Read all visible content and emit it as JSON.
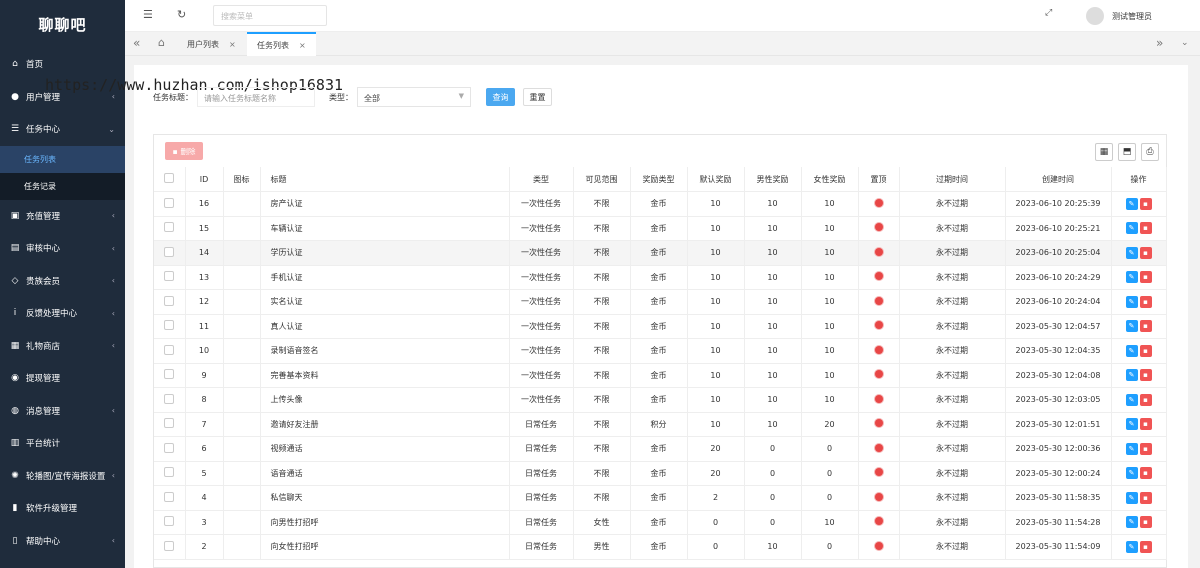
{
  "app": {
    "logo": "聊聊吧"
  },
  "sidebar": {
    "items": [
      {
        "icon": "home-icon",
        "glyph": "⌂",
        "label": "首页",
        "arrow": ""
      },
      {
        "icon": "user-icon",
        "glyph": "●",
        "label": "用户管理",
        "arrow": "‹"
      },
      {
        "icon": "list-icon",
        "glyph": "☰",
        "label": "任务中心",
        "arrow": "⌄"
      }
    ],
    "sub_items": [
      {
        "label": "任务列表"
      },
      {
        "label": "任务记录"
      }
    ],
    "items2": [
      {
        "icon": "gift-box-icon",
        "glyph": "▣",
        "label": "充值管理",
        "arrow": "‹"
      },
      {
        "icon": "stamp-icon",
        "glyph": "▤",
        "label": "审核中心",
        "arrow": "‹"
      },
      {
        "icon": "diamond-icon",
        "glyph": "◇",
        "label": "贵族会员",
        "arrow": "‹"
      },
      {
        "icon": "info-icon",
        "glyph": "i",
        "label": "反馈处理中心",
        "arrow": "‹"
      },
      {
        "icon": "gift-icon",
        "glyph": "▦",
        "label": "礼物商店",
        "arrow": "‹"
      },
      {
        "icon": "money-bag-icon",
        "glyph": "◉",
        "label": "提现管理",
        "arrow": ""
      },
      {
        "icon": "chat-icon",
        "glyph": "◍",
        "label": "消息管理",
        "arrow": "‹"
      },
      {
        "icon": "bar-chart-icon",
        "glyph": "▥",
        "label": "平台统计",
        "arrow": ""
      },
      {
        "icon": "gear-icon",
        "glyph": "✺",
        "label": "轮播图/宣传海报设置",
        "arrow": "‹"
      },
      {
        "icon": "lock-icon",
        "glyph": "▮",
        "label": "软件升级管理",
        "arrow": ""
      },
      {
        "icon": "book-icon",
        "glyph": "▯",
        "label": "帮助中心",
        "arrow": "‹"
      }
    ]
  },
  "header": {
    "search_placeholder": "搜索菜单",
    "user_name": "测试管理员"
  },
  "tabs": [
    {
      "label": "用户列表"
    },
    {
      "label": "任务列表"
    }
  ],
  "watermark": "https://www.huzhan.com/ishop16831",
  "filters": {
    "title_label": "任务标题：",
    "title_placeholder": "请输入任务标题名称",
    "type_label": "类型：",
    "type_value": "全部",
    "query_label": "查询",
    "reset_label": "重置"
  },
  "toolbar": {
    "delete_label": "删除"
  },
  "table": {
    "columns": [
      "ID",
      "图标",
      "标题",
      "类型",
      "可见范围",
      "奖励类型",
      "默认奖励",
      "男性奖励",
      "女性奖励",
      "置顶",
      "过期时间",
      "创建时间",
      "操作"
    ],
    "rows": [
      {
        "id": "16",
        "title": "房产认证",
        "type": "一次性任务",
        "scope": "不限",
        "reward_type": "金币",
        "default": "10",
        "male": "10",
        "female": "10",
        "expire": "永不过期",
        "created": "2023-06-10 20:25:39"
      },
      {
        "id": "15",
        "title": "车辆认证",
        "type": "一次性任务",
        "scope": "不限",
        "reward_type": "金币",
        "default": "10",
        "male": "10",
        "female": "10",
        "expire": "永不过期",
        "created": "2023-06-10 20:25:21"
      },
      {
        "id": "14",
        "title": "学历认证",
        "type": "一次性任务",
        "scope": "不限",
        "reward_type": "金币",
        "default": "10",
        "male": "10",
        "female": "10",
        "expire": "永不过期",
        "created": "2023-06-10 20:25:04"
      },
      {
        "id": "13",
        "title": "手机认证",
        "type": "一次性任务",
        "scope": "不限",
        "reward_type": "金币",
        "default": "10",
        "male": "10",
        "female": "10",
        "expire": "永不过期",
        "created": "2023-06-10 20:24:29"
      },
      {
        "id": "12",
        "title": "实名认证",
        "type": "一次性任务",
        "scope": "不限",
        "reward_type": "金币",
        "default": "10",
        "male": "10",
        "female": "10",
        "expire": "永不过期",
        "created": "2023-06-10 20:24:04"
      },
      {
        "id": "11",
        "title": "真人认证",
        "type": "一次性任务",
        "scope": "不限",
        "reward_type": "金币",
        "default": "10",
        "male": "10",
        "female": "10",
        "expire": "永不过期",
        "created": "2023-05-30 12:04:57"
      },
      {
        "id": "10",
        "title": "录制语音签名",
        "type": "一次性任务",
        "scope": "不限",
        "reward_type": "金币",
        "default": "10",
        "male": "10",
        "female": "10",
        "expire": "永不过期",
        "created": "2023-05-30 12:04:35"
      },
      {
        "id": "9",
        "title": "完善基本资料",
        "type": "一次性任务",
        "scope": "不限",
        "reward_type": "金币",
        "default": "10",
        "male": "10",
        "female": "10",
        "expire": "永不过期",
        "created": "2023-05-30 12:04:08"
      },
      {
        "id": "8",
        "title": "上传头像",
        "type": "一次性任务",
        "scope": "不限",
        "reward_type": "金币",
        "default": "10",
        "male": "10",
        "female": "10",
        "expire": "永不过期",
        "created": "2023-05-30 12:03:05"
      },
      {
        "id": "7",
        "title": "邀请好友注册",
        "type": "日常任务",
        "scope": "不限",
        "reward_type": "积分",
        "default": "10",
        "male": "10",
        "female": "20",
        "expire": "永不过期",
        "created": "2023-05-30 12:01:51"
      },
      {
        "id": "6",
        "title": "视频通话",
        "type": "日常任务",
        "scope": "不限",
        "reward_type": "金币",
        "default": "20",
        "male": "0",
        "female": "0",
        "expire": "永不过期",
        "created": "2023-05-30 12:00:36"
      },
      {
        "id": "5",
        "title": "语音通话",
        "type": "日常任务",
        "scope": "不限",
        "reward_type": "金币",
        "default": "20",
        "male": "0",
        "female": "0",
        "expire": "永不过期",
        "created": "2023-05-30 12:00:24"
      },
      {
        "id": "4",
        "title": "私信聊天",
        "type": "日常任务",
        "scope": "不限",
        "reward_type": "金币",
        "default": "2",
        "male": "0",
        "female": "0",
        "expire": "永不过期",
        "created": "2023-05-30 11:58:35"
      },
      {
        "id": "3",
        "title": "向男性打招呼",
        "type": "日常任务",
        "scope": "女性",
        "reward_type": "金币",
        "default": "0",
        "male": "0",
        "female": "10",
        "expire": "永不过期",
        "created": "2023-05-30 11:54:28"
      },
      {
        "id": "2",
        "title": "向女性打招呼",
        "type": "日常任务",
        "scope": "男性",
        "reward_type": "金币",
        "default": "0",
        "male": "10",
        "female": "0",
        "expire": "永不过期",
        "created": "2023-05-30 11:54:09"
      }
    ]
  }
}
